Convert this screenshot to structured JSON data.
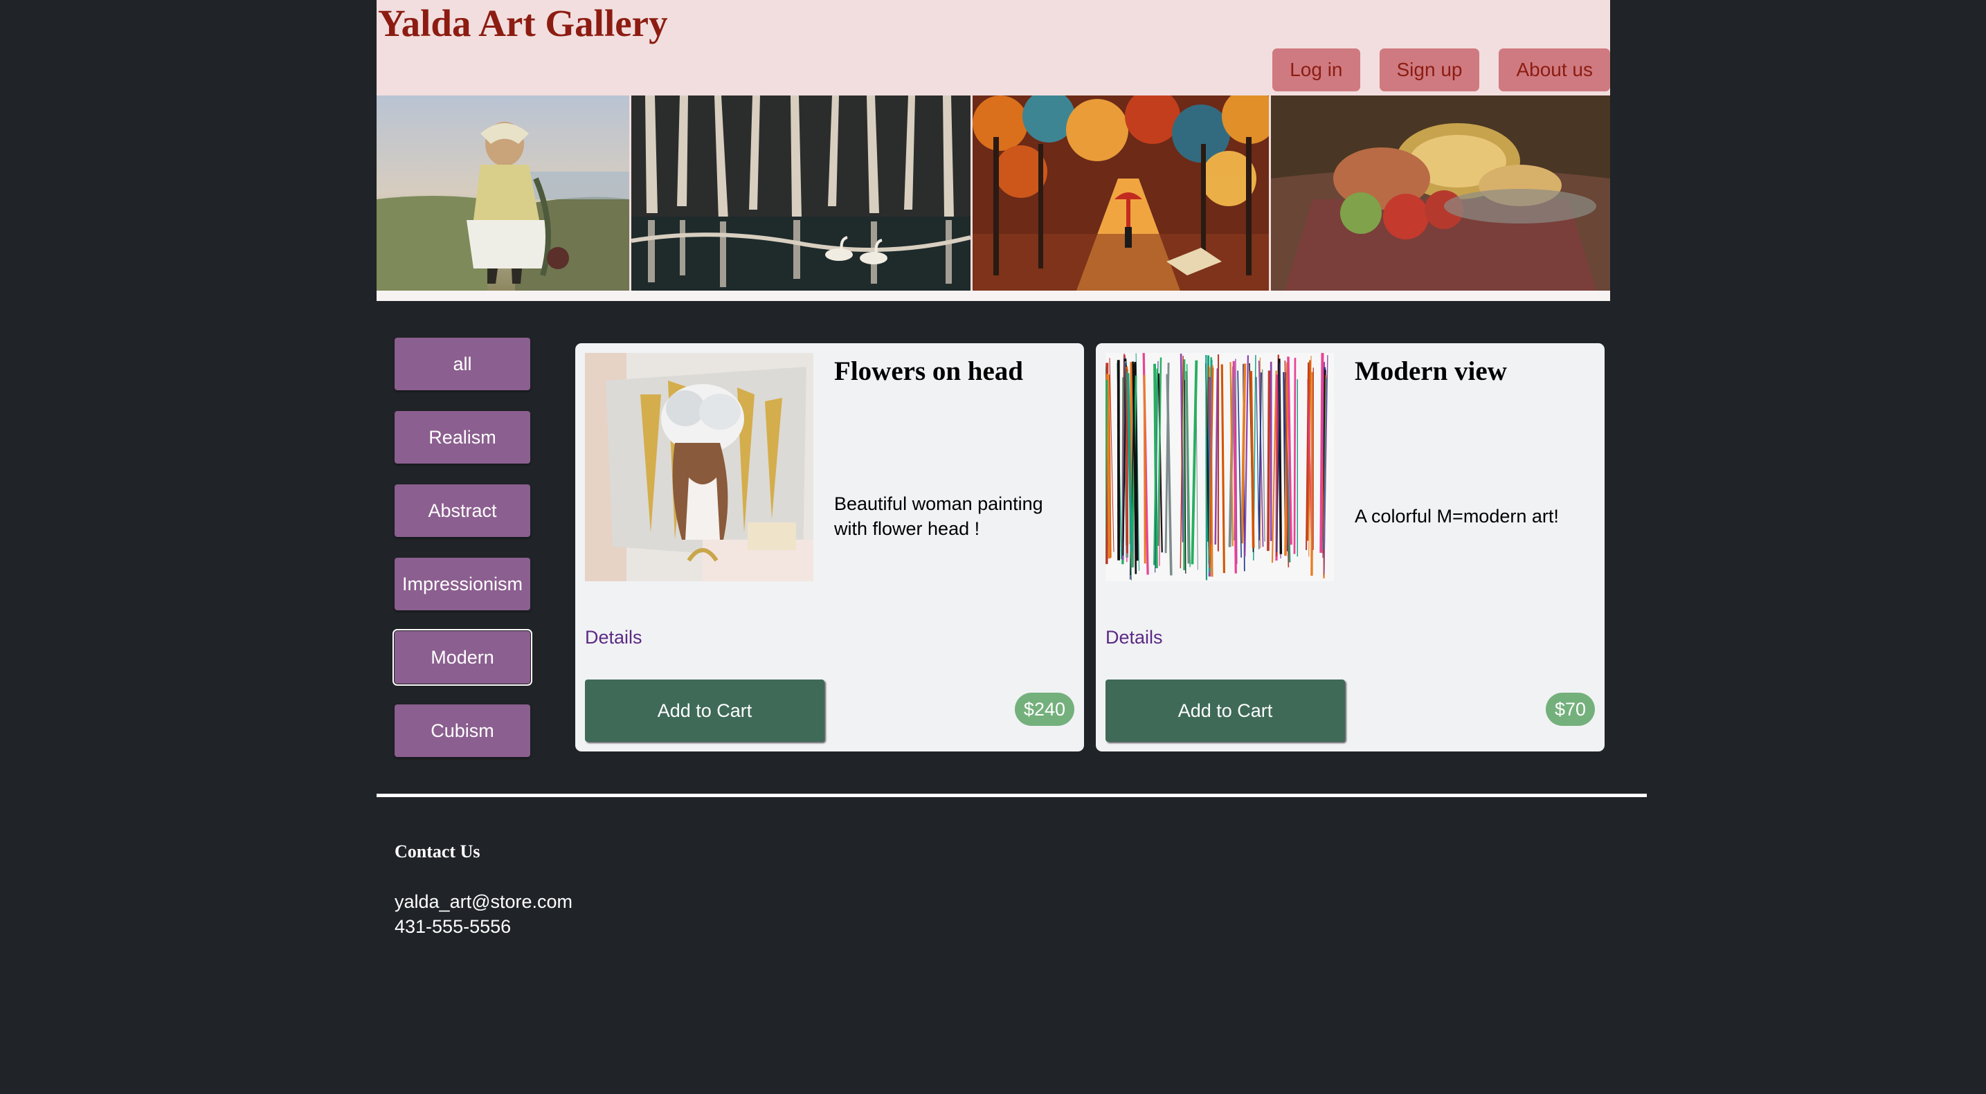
{
  "site": {
    "title": "Yalda Art Gallery"
  },
  "nav": {
    "login": "Log in",
    "signup": "Sign up",
    "about": "About us"
  },
  "banner": {
    "paintings": [
      "woman-by-sea-painting",
      "birch-forest-swans-painting",
      "rainy-autumn-street-painting",
      "fruit-still-life-painting"
    ]
  },
  "filters": {
    "items": [
      "all",
      "Realism",
      "Abstract",
      "Impressionism",
      "Modern",
      "Cubism"
    ],
    "selected": "Modern"
  },
  "products": [
    {
      "title": "Flowers on head",
      "description": "Beautiful woman painting with flower head !",
      "details_label": "Details",
      "cart_label": "Add to Cart",
      "price": "$240",
      "image": "woman-flower-head-painting"
    },
    {
      "title": "Modern view",
      "description": "A colorful M=modern art!",
      "details_label": "Details",
      "cart_label": "Add to Cart",
      "price": "$70",
      "image": "colorful-drip-lines-painting"
    }
  ],
  "footer": {
    "title": "Contact Us",
    "email": "yalda_art@store.com",
    "phone": "431-555-5556"
  },
  "colors": {
    "page_bg": "#202327",
    "header_bg": "#f2dede",
    "title": "#8c1c12",
    "nav_button": "#cf7a80",
    "filter_button": "#8b5f8f",
    "cart_button": "#3f6a58",
    "price_badge": "#74b07c",
    "details_link": "#5b2a84"
  }
}
